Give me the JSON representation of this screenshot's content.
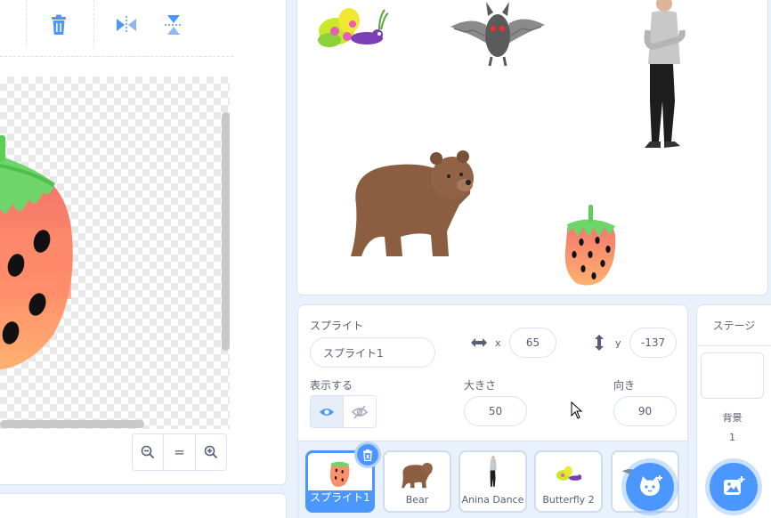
{
  "paint_editor": {
    "toolbar_icons": [
      "trash-icon",
      "flip-horizontal-icon",
      "flip-vertical-icon"
    ],
    "zoom": {
      "zoom_out": "−",
      "reset": "=",
      "zoom_in": "+"
    }
  },
  "sprite_info": {
    "sprite_label": "スプライト",
    "name_value": "スプライト1",
    "x_label": "x",
    "x_value": "65",
    "y_label": "y",
    "y_value": "-137",
    "show_label": "表示する",
    "size_label": "大きさ",
    "size_value": "50",
    "direction_label": "向き",
    "direction_value": "90"
  },
  "sprites": [
    {
      "name": "スプライト1",
      "selected": true
    },
    {
      "name": "Bear"
    },
    {
      "name": "Anina Dance"
    },
    {
      "name": "Butterfly 2"
    }
  ],
  "stage_pane": {
    "title": "ステージ",
    "backdrops_label": "背景",
    "backdrops_count": "1"
  },
  "colors": {
    "accent": "#4c97ff",
    "panel_border": "#d9e3f2",
    "text": "#575e75",
    "background": "#e9f1fc"
  }
}
